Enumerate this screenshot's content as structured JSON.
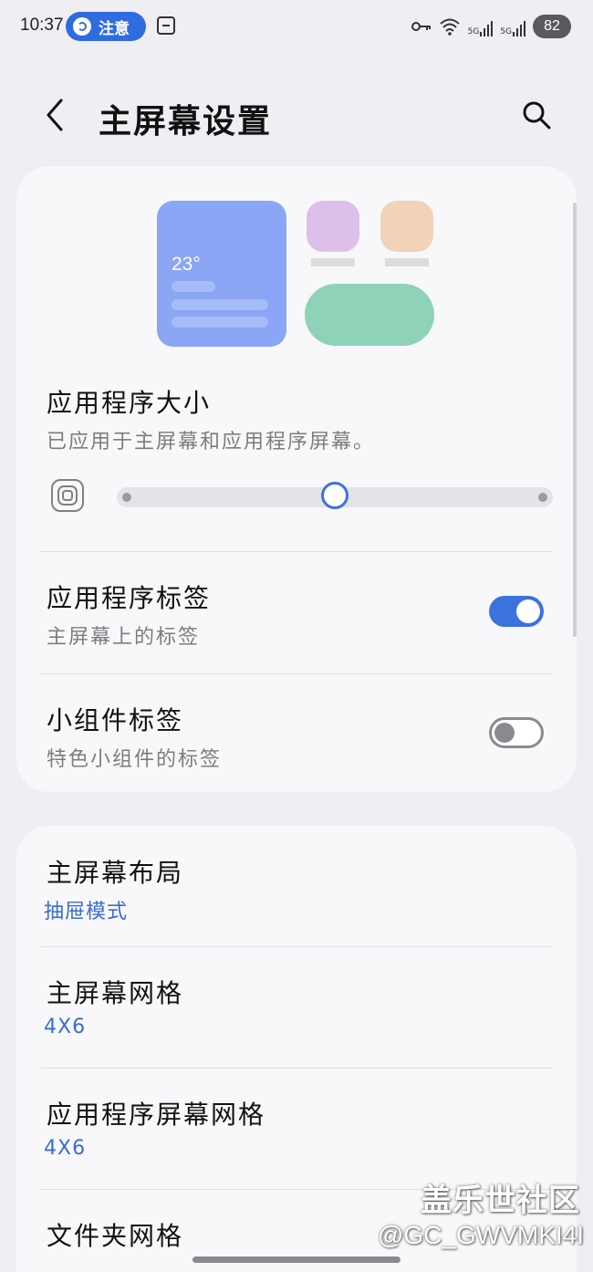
{
  "status_bar": {
    "time": "10:37",
    "notice_label": "注意",
    "network_1": "5G",
    "network_2": "5G",
    "battery": "82"
  },
  "header": {
    "title": "主屏幕设置"
  },
  "preview": {
    "weather_temp": "23°",
    "colors": {
      "widget_blue": "#8aa6f5",
      "icon_purple": "#dcc0ea",
      "icon_peach": "#f0d3b8",
      "widget_green": "#8ed2b7"
    }
  },
  "app_size": {
    "title": "应用程序大小",
    "subtitle": "已应用于主屏幕和应用程序屏幕。",
    "slider_fraction": 0.5
  },
  "settings_top": [
    {
      "title": "应用程序标签",
      "subtitle": "主屏幕上的标签",
      "toggle_on": true
    },
    {
      "title": "小组件标签",
      "subtitle": "特色小组件的标签",
      "toggle_on": false
    }
  ],
  "settings_bottom": [
    {
      "title": "主屏幕布局",
      "value": "抽屉模式"
    },
    {
      "title": "主屏幕网格",
      "value": "4X6"
    },
    {
      "title": "应用程序屏幕网格",
      "value": "4X6"
    },
    {
      "title": "文件夹网格"
    }
  ],
  "watermark": {
    "site": "盖乐世社区",
    "user": "@GC_GWVMKI4I"
  },
  "accent_color": "#3a72e0"
}
